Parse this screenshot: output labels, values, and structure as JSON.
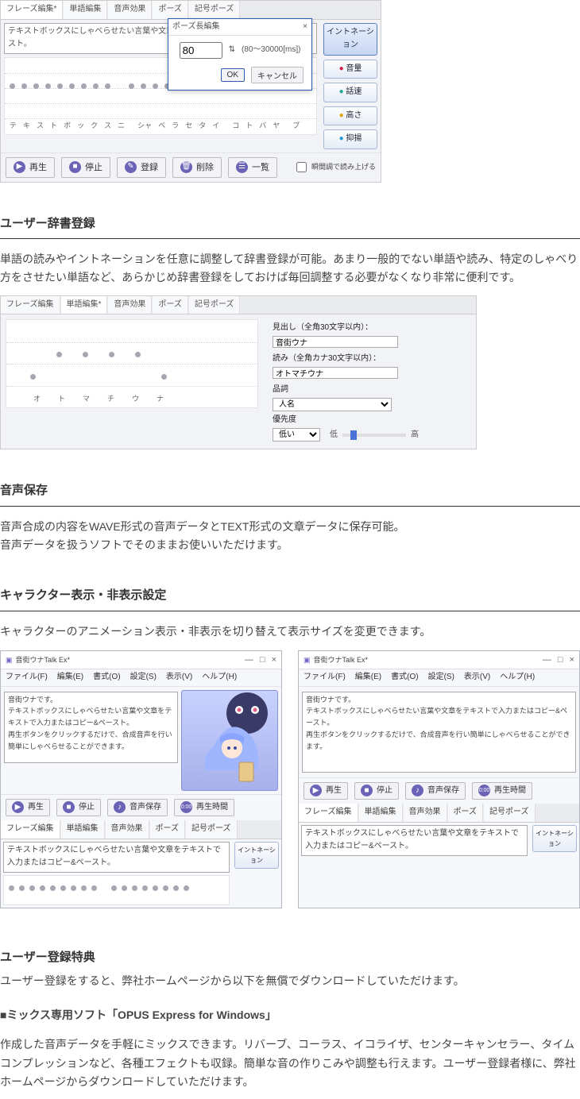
{
  "mock1": {
    "tabs": [
      "フレーズ編集*",
      "単語編集",
      "音声効果",
      "ポーズ",
      "記号ポーズ"
    ],
    "sentence": "テキストボックスにしゃべらせたい言葉や文章をテキストで入力またはコピー＆ペースト。",
    "kana": [
      "テ",
      "キ",
      "ス",
      "ト",
      "ボ",
      "ッ",
      "ク",
      "ス",
      "ニ",
      "",
      "シャ",
      "ベ",
      "ラ",
      "セ",
      "タ",
      "イ",
      "",
      "コ",
      "ト",
      "バ",
      "ヤ",
      "",
      "ブ"
    ],
    "right_buttons": [
      "イントネーション",
      "音量",
      "話速",
      "高さ",
      "抑揚"
    ],
    "bottom_buttons": [
      "再生",
      "停止",
      "登録",
      "削除",
      "一覧"
    ],
    "checkbox": "瞬間調で読み上げる",
    "popup": {
      "title": "ポーズ長編集",
      "value": "80",
      "range_label": "(80～30000[ms])",
      "ok": "OK",
      "cancel": "キャンセル"
    }
  },
  "sec_dict": {
    "title": "ユーザー辞書登録",
    "body": "単語の読みやイントネーションを任意に調整して辞書登録が可能。あまり一般的でない単語や読み、特定のしゃべり方をさせたい単語など、あらかじめ辞書登録をしておけば毎回調整する必要がなくなり非常に便利です。"
  },
  "mock2": {
    "tabs": [
      "フレーズ編集",
      "単語編集*",
      "音声効果",
      "ポーズ",
      "記号ポーズ"
    ],
    "kana": [
      "オ",
      "ト",
      "マ",
      "チ",
      "ウ",
      "ナ"
    ],
    "fields": {
      "headword_label": "見出し（全角30文字以内）：",
      "headword_value": "音街ウナ",
      "reading_label": "読み（全角カナ30文字以内）：",
      "reading_value": "オトマチウナ",
      "pos_label": "品詞",
      "pos_value": "人名",
      "priority_label": "優先度",
      "priority_value": "低い",
      "low": "低",
      "high": "高"
    }
  },
  "sec_audio": {
    "title": "音声保存",
    "body1": "音声合成の内容をWAVE形式の音声データとTEXT形式の文章データに保存可能。",
    "body2": "音声データを扱うソフトでそのままお使いいただけます。"
  },
  "sec_char": {
    "title": "キャラクター表示・非表示設定",
    "body": "キャラクターのアニメーション表示・非表示を切り替えて表示サイズを変更できます。"
  },
  "winA": {
    "title": "音街ウナTalk Ex*",
    "menu": [
      "ファイル(F)",
      "編集(E)",
      "書式(O)",
      "設定(S)",
      "表示(V)",
      "ヘルプ(H)"
    ],
    "text1": "音街ウナです。",
    "text2": "テキストボックスにしゃべらせたい言葉や文章をテキストで入力またはコピー&ペースト。",
    "text3": "再生ボタンをクリックするだけで、合成音声を行い簡単にしゃべらせることができます。",
    "buttons": [
      "再生",
      "停止",
      "音声保存",
      "再生時間"
    ],
    "tabs": [
      "フレーズ編集",
      "単語編集",
      "音声効果",
      "ポーズ",
      "記号ポーズ"
    ],
    "lower_text": "テキストボックスにしゃべらせたい言葉や文章をテキストで入力またはコピー&ペースト。",
    "right_btn": "イントネーション"
  },
  "sec_bonus": {
    "title": "ユーザー登録特典",
    "body": "ユーザー登録をすると、弊社ホームページから以下を無償でダウンロードしていただけます。",
    "sub": "■ミックス専用ソフト「OPUS Express for Windows」",
    "sub_body": "作成した音声データを手軽にミックスできます。リバーブ、コーラス、イコライザ、センターキャンセラー、タイムコンプレッションなど、各種エフェクトも収録。簡単な音の作りこみや調整も行えます。ユーザー登録者様に、弊社ホームページからダウンロードしていただけます。"
  }
}
